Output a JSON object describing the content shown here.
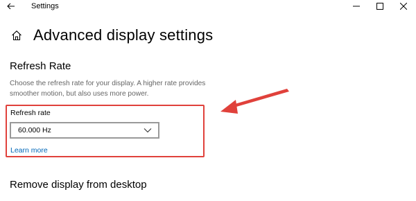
{
  "window": {
    "title": "Settings",
    "controls": {
      "back_icon": "back-arrow-icon",
      "minimize_icon": "minimize-icon",
      "maximize_icon": "maximize-icon",
      "close_icon": "close-icon"
    }
  },
  "header": {
    "home_icon": "home-icon",
    "title": "Advanced display settings"
  },
  "refresh_rate_section": {
    "heading": "Refresh Rate",
    "description": "Choose the refresh rate for your display. A higher rate provides smoother motion, but also uses more power.",
    "field_label": "Refresh rate",
    "selected_value": "60.000 Hz",
    "learn_more": "Learn more"
  },
  "next_section": {
    "heading": "Remove display from desktop"
  },
  "annotation": {
    "highlight_color": "#e0413b",
    "arrow_color": "#e0413b"
  },
  "colors": {
    "link": "#0067b8",
    "description_text": "#666666",
    "dropdown_border": "#999999"
  }
}
